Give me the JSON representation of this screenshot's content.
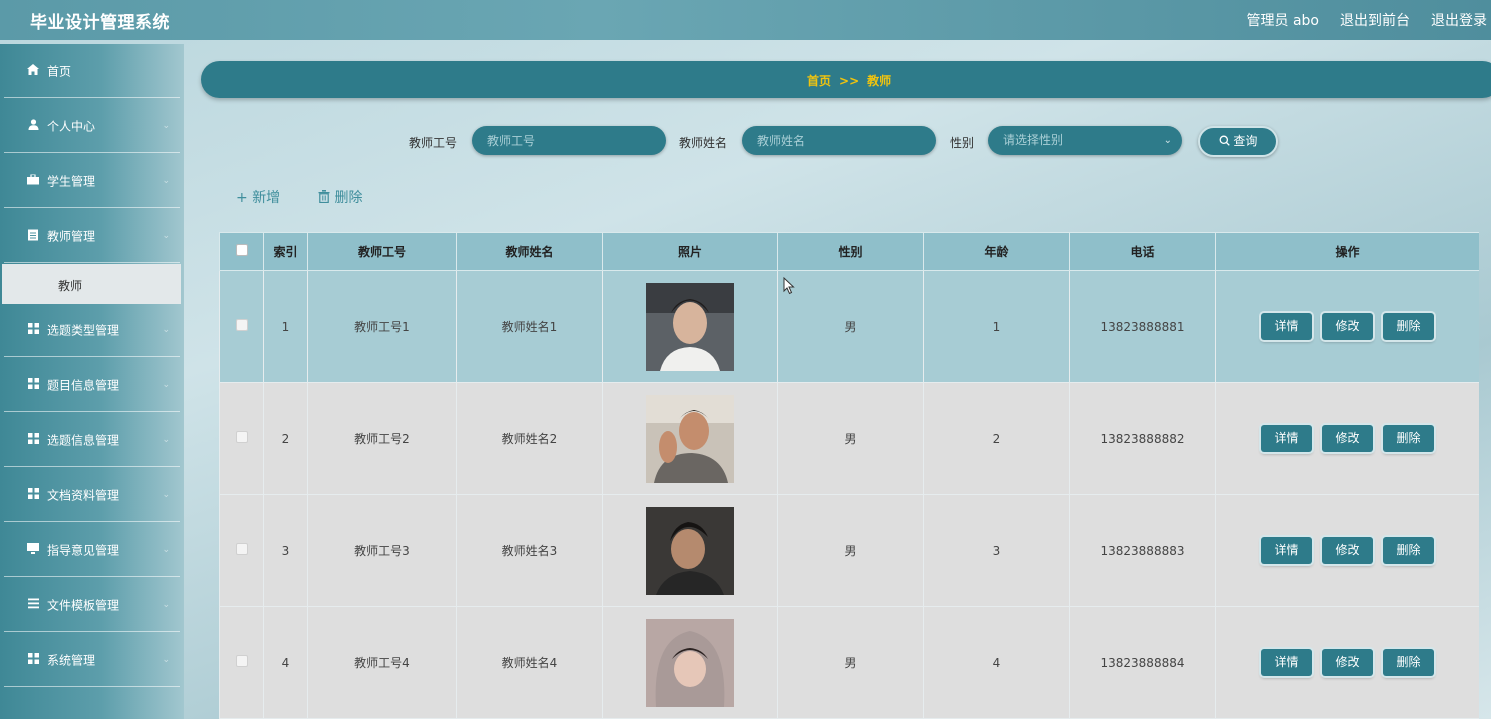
{
  "app": {
    "title": "毕业设计管理系统"
  },
  "header": {
    "user": "管理员 abo",
    "front_link": "退出到前台",
    "logout": "退出登录"
  },
  "sidebar": {
    "items": [
      {
        "label": "首页",
        "icon": "home-icon"
      },
      {
        "label": "个人中心",
        "icon": "user-icon"
      },
      {
        "label": "学生管理",
        "icon": "briefcase-icon"
      },
      {
        "label": "教师管理",
        "icon": "clipboard-icon"
      },
      {
        "label": "选题类型管理",
        "icon": "grid-icon"
      },
      {
        "label": "题目信息管理",
        "icon": "grid-icon"
      },
      {
        "label": "选题信息管理",
        "icon": "grid-icon"
      },
      {
        "label": "文档资料管理",
        "icon": "grid-icon"
      },
      {
        "label": "指导意见管理",
        "icon": "monitor-icon"
      },
      {
        "label": "文件模板管理",
        "icon": "list-icon"
      },
      {
        "label": "系统管理",
        "icon": "grid-icon"
      }
    ],
    "sub_item": "教师"
  },
  "breadcrumb": {
    "home": "首页",
    "sep": ">>",
    "current": "教师"
  },
  "search": {
    "id_label": "教师工号",
    "id_placeholder": "教师工号",
    "name_label": "教师姓名",
    "name_placeholder": "教师姓名",
    "gender_label": "性别",
    "gender_placeholder": "请选择性别",
    "query_button": "查询"
  },
  "actions": {
    "add": "新增",
    "delete": "删除"
  },
  "table": {
    "headers": [
      "索引",
      "教师工号",
      "教师姓名",
      "照片",
      "性别",
      "年龄",
      "电话",
      "操作"
    ],
    "rows": [
      {
        "index": "1",
        "id": "教师工号1",
        "name": "教师姓名1",
        "gender": "男",
        "age": "1",
        "phone": "13823888881"
      },
      {
        "index": "2",
        "id": "教师工号2",
        "name": "教师姓名2",
        "gender": "男",
        "age": "2",
        "phone": "13823888882"
      },
      {
        "index": "3",
        "id": "教师工号3",
        "name": "教师姓名3",
        "gender": "男",
        "age": "3",
        "phone": "13823888883"
      },
      {
        "index": "4",
        "id": "教师工号4",
        "name": "教师姓名4",
        "gender": "男",
        "age": "4",
        "phone": "13823888884"
      }
    ],
    "op_labels": {
      "detail": "详情",
      "edit": "修改",
      "delete": "删除"
    }
  },
  "colors": {
    "primary": "#2e7b8a",
    "breadcrumb_text": "#f1c40f",
    "header_row": "#8fbfca"
  }
}
